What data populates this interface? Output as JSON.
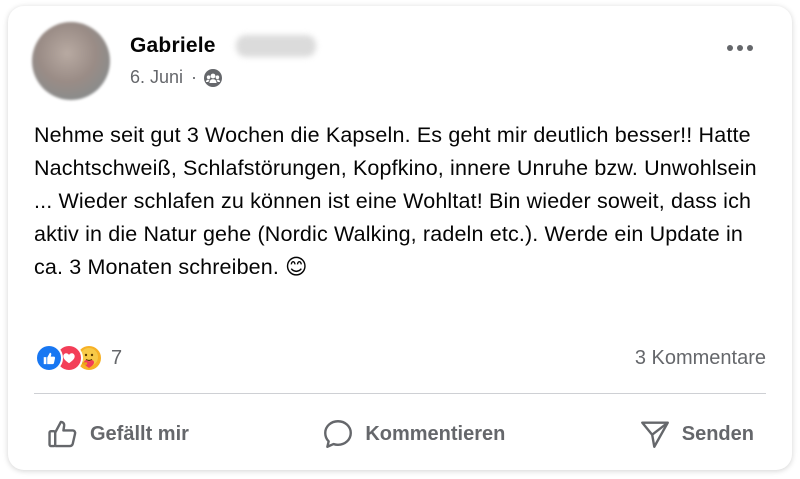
{
  "post": {
    "author_first": "Gabriele",
    "date": "6. Juni",
    "separator": "·",
    "audience_icon": "friends-icon",
    "more_icon": "more-horizontal-icon",
    "text": "Nehme seit gut 3 Wochen die Kapseln. Es geht mir deutlich besser!! Hatte Nachtschweiß, Schlafstörungen, Kopfkino, innere Unruhe bzw. Unwohlsein ... Wieder schlafen zu können ist eine Wohltat! Bin wieder soweit, dass ich aktiv in die Natur gehe (Nordic Walking, radeln etc.). Werde ein Update in ca. 3 Monaten schreiben.",
    "text_emoji": "😊"
  },
  "stats": {
    "reactions": [
      "like",
      "love",
      "care"
    ],
    "reaction_count": "7",
    "comments": "3 Kommentare"
  },
  "actions": {
    "like_label": "Gefällt mir",
    "comment_label": "Kommentieren",
    "share_label": "Senden"
  },
  "colors": {
    "like": "#1877f2",
    "love": "#f33e58",
    "care": "#f7b125",
    "secondary_text": "#65676b"
  }
}
